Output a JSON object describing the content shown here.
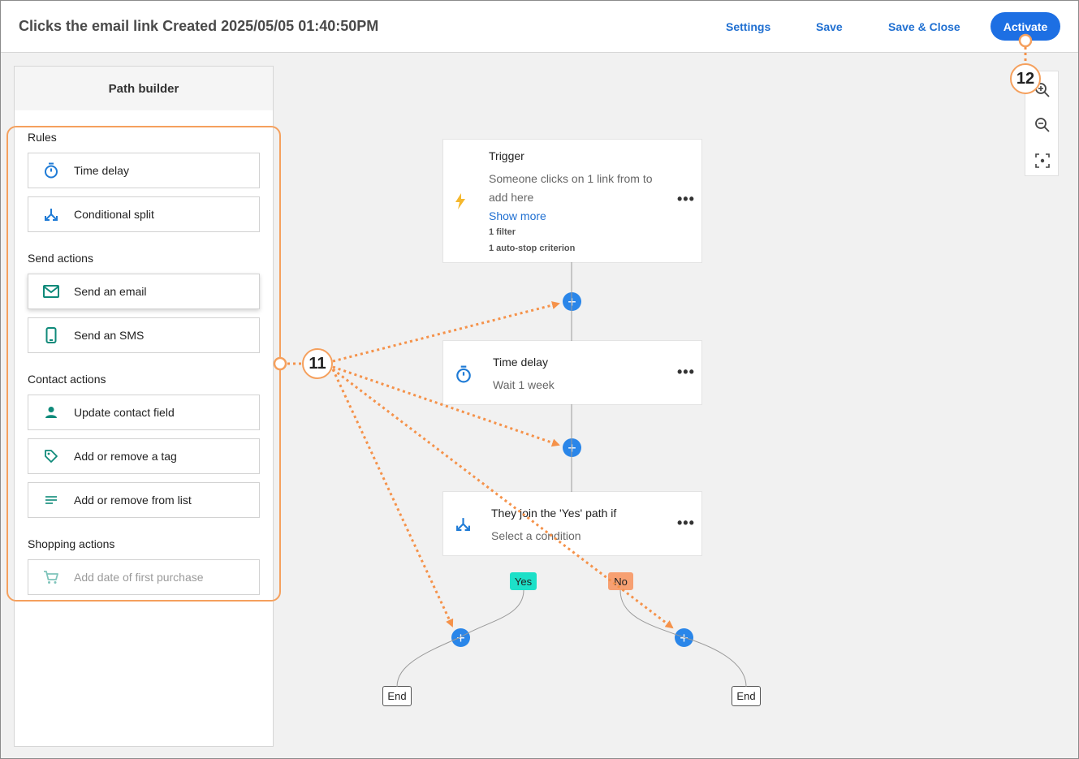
{
  "header": {
    "title": "Clicks the email link Created 2025/05/05 01:40:50PM",
    "settings_label": "Settings",
    "save_label": "Save",
    "save_close_label": "Save & Close",
    "activate_label": "Activate"
  },
  "sidebar": {
    "title": "Path builder",
    "sections": [
      {
        "label": "Rules",
        "items": [
          {
            "label": "Time delay",
            "icon": "stopwatch-icon"
          },
          {
            "label": "Conditional split",
            "icon": "split-icon"
          }
        ]
      },
      {
        "label": "Send actions",
        "items": [
          {
            "label": "Send an email",
            "icon": "envelope-icon"
          },
          {
            "label": "Send an SMS",
            "icon": "phone-icon"
          }
        ]
      },
      {
        "label": "Contact actions",
        "items": [
          {
            "label": "Update contact field",
            "icon": "person-icon"
          },
          {
            "label": "Add or remove a tag",
            "icon": "tag-icon"
          },
          {
            "label": "Add or remove from list",
            "icon": "list-icon"
          }
        ]
      },
      {
        "label": "Shopping actions",
        "items": [
          {
            "label": "Add date of first purchase",
            "icon": "cart-icon",
            "disabled": true
          }
        ]
      }
    ]
  },
  "canvas": {
    "trigger": {
      "title": "Trigger",
      "line1": "Someone clicks on 1 link from to",
      "line2": "add here",
      "show_more": "Show more",
      "filter": "1 filter",
      "autostop": "1 auto-stop criterion",
      "icon": "lightning-icon"
    },
    "time_delay": {
      "title": "Time delay",
      "sub": "Wait 1 week",
      "icon": "stopwatch-icon"
    },
    "condition": {
      "title": "They join the 'Yes' path if",
      "sub": "Select a condition",
      "icon": "split-icon"
    },
    "yes_label": "Yes",
    "no_label": "No",
    "end_label": "End",
    "menu_glyph": "•••",
    "plus_glyph": "+"
  },
  "callouts": {
    "sidebar_callout": "11",
    "activate_callout": "12"
  },
  "colors": {
    "accent": "#1d6fe3",
    "plus": "#2a86e9",
    "callout": "#f5a05d",
    "yes": "#1de0c8",
    "no": "#f7a072",
    "icon_blue": "#1f7bd6",
    "icon_teal": "#0f8a7a"
  }
}
